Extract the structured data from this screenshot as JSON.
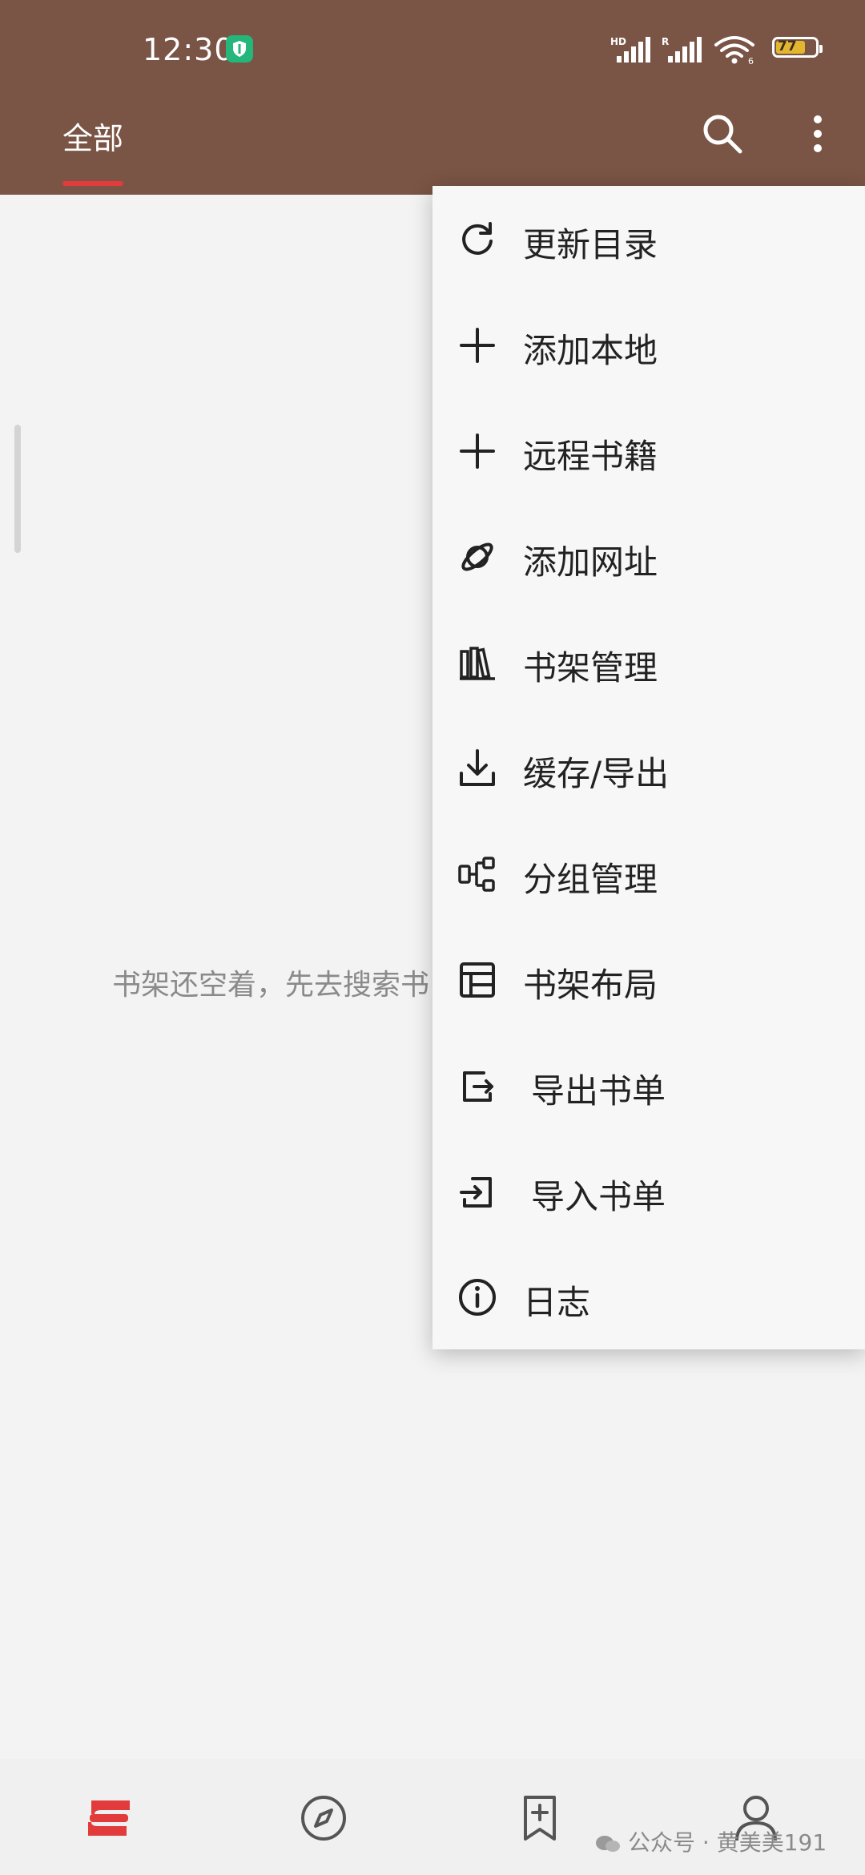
{
  "status_bar": {
    "time": "12:30",
    "battery": "77"
  },
  "app_bar": {
    "tab_all": "全部"
  },
  "empty_message": "书架还空着，先去搜索书",
  "menu": {
    "items": [
      {
        "label": "更新目录",
        "icon": "refresh-icon"
      },
      {
        "label": "添加本地",
        "icon": "plus-icon"
      },
      {
        "label": "远程书籍",
        "icon": "plus-icon"
      },
      {
        "label": "添加网址",
        "icon": "planet-icon"
      },
      {
        "label": "书架管理",
        "icon": "bookshelf-icon"
      },
      {
        "label": "缓存/导出",
        "icon": "download-icon"
      },
      {
        "label": "分组管理",
        "icon": "group-icon"
      },
      {
        "label": "书架布局",
        "icon": "layout-icon"
      },
      {
        "label": "导出书单",
        "icon": "export-icon"
      },
      {
        "label": "导入书单",
        "icon": "import-icon"
      },
      {
        "label": "日志",
        "icon": "info-icon"
      }
    ]
  },
  "bottom_nav": {
    "items": [
      "bookshelf-nav-icon",
      "compass-icon",
      "bookmark-add-icon",
      "profile-icon"
    ]
  },
  "watermark": "公众号 · 黄美美191",
  "colors": {
    "header": "#7a5445",
    "accent": "#e23b3b",
    "menu_bg": "#f7f7f7",
    "page_bg": "#f3f3f3"
  }
}
